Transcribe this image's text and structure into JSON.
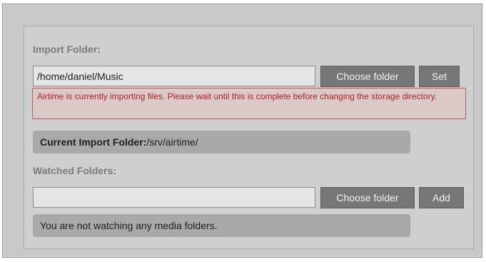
{
  "import_section": {
    "label": "Import Folder:",
    "path_value": "/home/daniel/Music",
    "choose_label": "Choose folder",
    "set_label": "Set",
    "error_message": "Airtime is currently importing files. Please wait until this is complete before changing the storage directory.",
    "current_label": "Current Import Folder:",
    "current_value": "/srv/airtime/"
  },
  "watched_section": {
    "label": "Watched Folders:",
    "path_value": "",
    "choose_label": "Choose folder",
    "add_label": "Add",
    "empty_message": "You are not watching any media folders."
  }
}
